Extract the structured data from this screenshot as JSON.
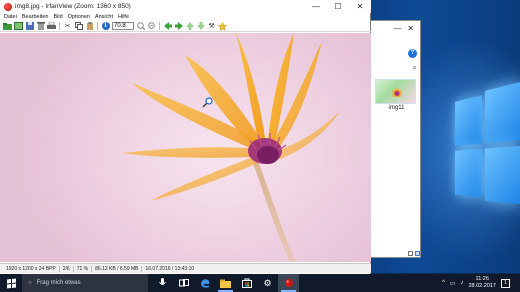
{
  "window": {
    "title": "img8.jpg - IrfanView (Zoom: 1360 x 850)",
    "minimize": "—",
    "maximize": "☐",
    "close": "✕"
  },
  "menu": [
    "Datei",
    "Bearbeiten",
    "Bild",
    "Optionen",
    "Ansicht",
    "Hilfe"
  ],
  "toolbar": {
    "zoom_value": "70.8",
    "icons": [
      "open-icon",
      "slideshow-icon",
      "save-icon",
      "delete-icon",
      "print-icon",
      "cut-icon",
      "copy-icon",
      "paste-icon",
      "info-icon",
      "zoom-box",
      "zoom-in-icon",
      "zoom-out-icon",
      "prev-icon",
      "next-icon",
      "first-icon",
      "last-icon",
      "tools-icon",
      "favorite-icon"
    ]
  },
  "status": {
    "resolution": "1920 x 1200 x 24 BPP",
    "index": "2/6",
    "zoom_percent": "71 %",
    "filesize": "86.12 KB / 6.59 MB",
    "datetime": "16.07.2016 / 13:43:10"
  },
  "explorer": {
    "thumbnail_label": "img11",
    "help": "?"
  },
  "taskbar": {
    "search_placeholder": "Frag mich etwas",
    "time": "11:26",
    "date": "28.02.2017",
    "notif_count": "1"
  },
  "colors": {
    "accent": "#2266cc",
    "taskbar_bg": "#101a2a",
    "canvas_bg": "#efd2e2",
    "petal": "#f6a823"
  }
}
